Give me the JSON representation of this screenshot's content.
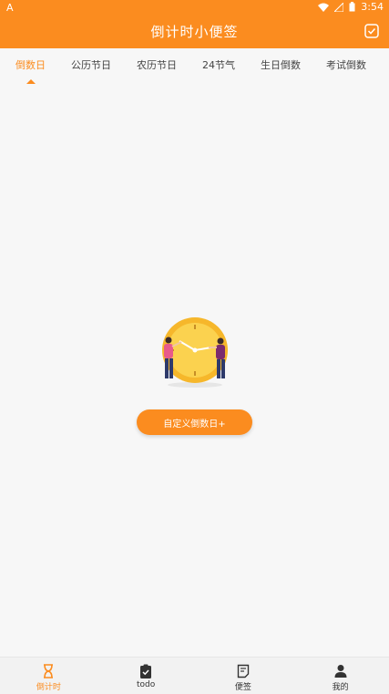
{
  "status_bar": {
    "left_icon": "A",
    "time": "3:54"
  },
  "app_bar": {
    "title": "倒计时小便签",
    "right_icon": "checkbox-icon"
  },
  "tabs": [
    {
      "label": "倒数日"
    },
    {
      "label": "公历节日"
    },
    {
      "label": "农历节日"
    },
    {
      "label": "24节气"
    },
    {
      "label": "生日倒数"
    },
    {
      "label": "考试倒数"
    }
  ],
  "empty_state": {
    "button_label": "自定义倒数日+",
    "illustration": "clock-people-illustration"
  },
  "bottom_nav": [
    {
      "label": "倒计时",
      "icon": "hourglass-icon"
    },
    {
      "label": "todo",
      "icon": "clipboard-check-icon"
    },
    {
      "label": "便签",
      "icon": "note-icon"
    },
    {
      "label": "我的",
      "icon": "person-icon"
    }
  ],
  "colors": {
    "accent": "#fb8c1f",
    "background": "#f7f7f7"
  }
}
